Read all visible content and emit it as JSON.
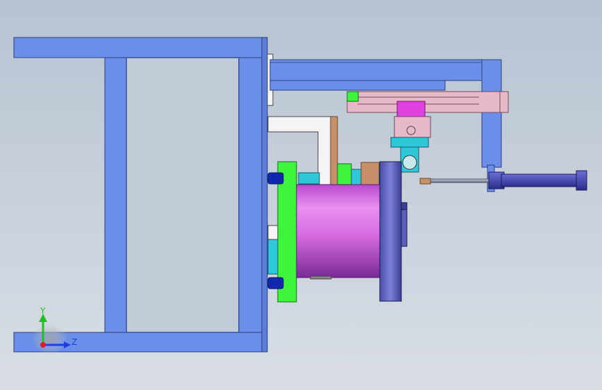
{
  "viewport": {
    "background_top": "#b7c3d3",
    "background_bottom": "#d9dee5"
  },
  "colors": {
    "frame_blue": "#6b8fe8",
    "frame_edge": "#2b3f7a",
    "cylinder_magenta": "#d66ae0",
    "plate_green": "#3df53d",
    "flange_navy": "#5a5fb8",
    "tan": "#c8906a",
    "pink": "#e6b8c8",
    "cyan": "#2fc8d8",
    "magenta_block": "#e040e0",
    "rod_grey": "#8a8fa0",
    "white": "#f4f4f4",
    "dark_blue": "#1028b0"
  },
  "triad": {
    "y_label": "Y",
    "z_label": "Z",
    "y_color": "#20c020",
    "z_color": "#2040e0",
    "origin_color": "#e02020"
  }
}
